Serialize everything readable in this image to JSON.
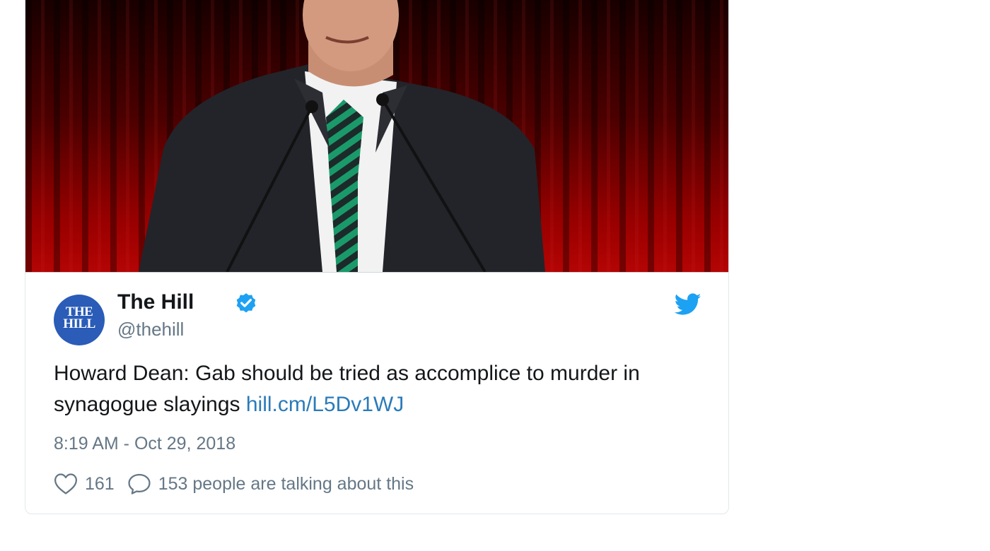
{
  "tweet": {
    "author_name": "The Hill",
    "author_handle": "@thehill",
    "avatar_text_line1": "THE",
    "avatar_text_line2": "HILL",
    "text_prefix": "Howard Dean: Gab should be tried as accomplice to murder in synagogue slayings ",
    "link_text": "hill.cm/L5Dv1WJ",
    "timestamp": "8:19 AM - Oct 29, 2018",
    "like_count": "161",
    "talking_text": "153 people are talking about this"
  },
  "colors": {
    "brand_blue": "#1da1f2",
    "link": "#2b7bb9",
    "muted": "#657786",
    "avatar_bg": "#2a5cb8"
  },
  "icons": {
    "verified": "verified-badge-icon",
    "bird": "twitter-bird-icon",
    "like": "heart-icon",
    "reply": "speech-bubble-icon"
  }
}
